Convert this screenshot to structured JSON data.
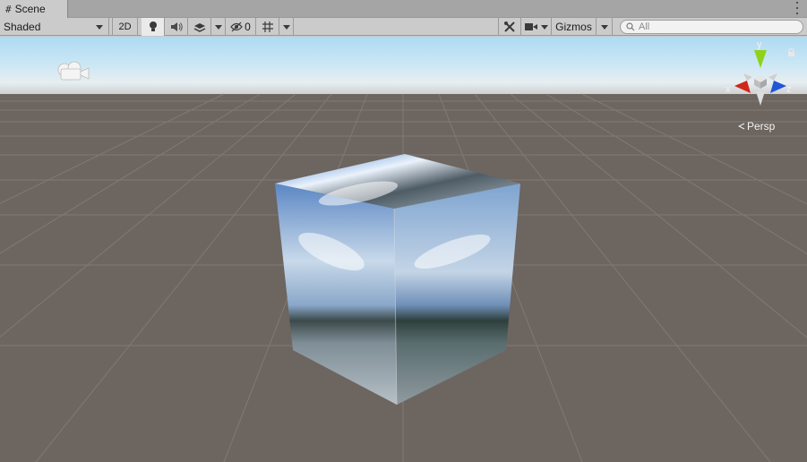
{
  "tab": {
    "title": "Scene"
  },
  "toolbar": {
    "draw_mode": "Shaded",
    "mode_2d": "2D",
    "hidden_count": "0",
    "gizmos_label": "Gizmos",
    "search_placeholder": "All"
  },
  "gizmo": {
    "y_label": "y",
    "x_label": "x",
    "z_label": "z"
  },
  "projection": {
    "label": "Persp"
  },
  "colors": {
    "x_axis": "#d0261b",
    "y_axis": "#8fd21b",
    "z_axis": "#1f57d6",
    "ground": "#6d6560",
    "sky_top": "#aedaf2"
  },
  "icons": [
    "hash-icon",
    "lighting-icon",
    "audio-icon",
    "effects-icon",
    "visibility-icon",
    "grid-icon",
    "tools-icon",
    "camera-icon",
    "search-icon",
    "scene-camera-icon",
    "lock-icon",
    "kebab-menu-icon"
  ]
}
